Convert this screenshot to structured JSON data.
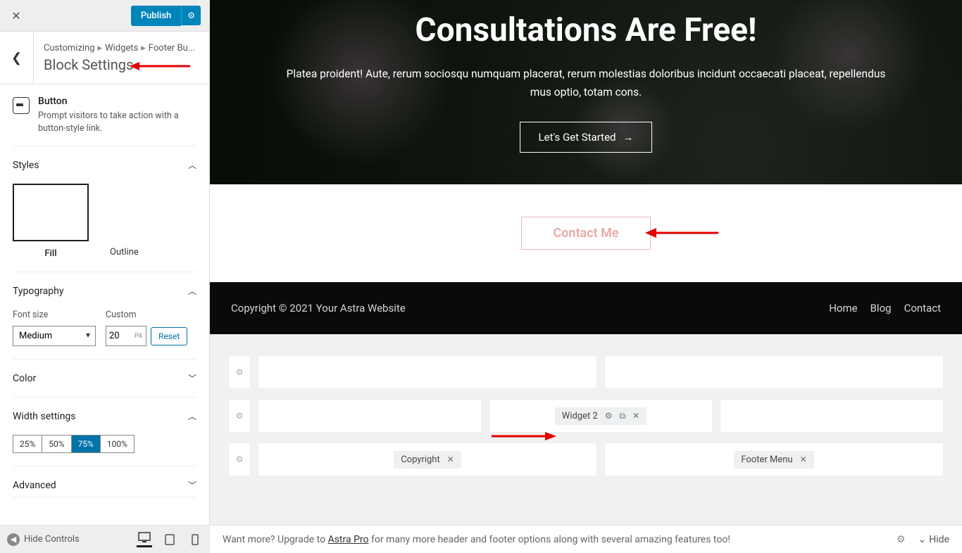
{
  "topbar": {
    "publish": "Publish"
  },
  "breadcrumb": {
    "a": "Customizing",
    "b": "Widgets",
    "c": "Footer Bu...",
    "title": "Block Settings"
  },
  "block": {
    "name": "Button",
    "desc": "Prompt visitors to take action with a button-style link."
  },
  "panels": {
    "styles": "Styles",
    "fill": "Fill",
    "outline": "Outline",
    "typography": "Typography",
    "fontsize_label": "Font size",
    "custom_label": "Custom",
    "medium": "Medium",
    "custom_value": "20",
    "px": "PX",
    "reset": "Reset",
    "color": "Color",
    "width": "Width settings",
    "w25": "25%",
    "w50": "50%",
    "w75": "75%",
    "w100": "100%",
    "advanced": "Advanced"
  },
  "bottom": {
    "hide_controls": "Hide Controls"
  },
  "hero": {
    "title": "Consultations Are Free!",
    "text": "Platea proident! Aute, rerum sociosqu numquam placerat, rerum molestias doloribus incidunt occaecati placeat, repellendus mus optio, totam cons.",
    "cta": "Let's Get Started"
  },
  "contact": "Contact Me",
  "footer": {
    "copyright": "Copyright © 2021 Your Astra Website",
    "home": "Home",
    "blog": "Blog",
    "contact": "Contact"
  },
  "builder": {
    "widget2": "Widget 2",
    "copyright": "Copyright",
    "footermenu": "Footer Menu"
  },
  "status": {
    "pre": "Want more? Upgrade to ",
    "link": "Astra Pro",
    "post": " for many more header and footer options along with several amazing features too!",
    "hide": "Hide"
  }
}
